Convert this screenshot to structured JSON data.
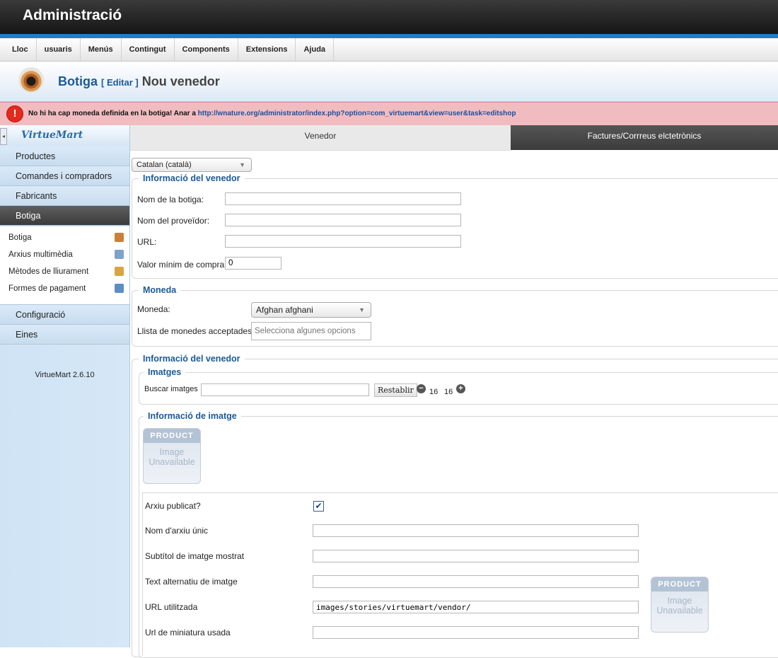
{
  "header": {
    "title": "Administració"
  },
  "menu": [
    "Lloc",
    "usuaris",
    "Menús",
    "Contingut",
    "Components",
    "Extensions",
    "Ajuda"
  ],
  "page": {
    "title": "Botiga",
    "edit": "[ Editar ]",
    "subtitle": "Nou venedor"
  },
  "alert": {
    "icon": "!",
    "text": "No hi ha cap moneda definida en la botiga! Anar a ",
    "link": "http://wnature.org/administrator/index.php?option=com_virtuemart&view=user&task=editshop"
  },
  "sidebar": {
    "logo": "VirtueMart",
    "collapse_icon": "◂",
    "items": [
      {
        "label": "Productes"
      },
      {
        "label": "Comandes i compradors"
      },
      {
        "label": "Fabricants"
      },
      {
        "label": "Botiga"
      }
    ],
    "sub_items": [
      {
        "label": "Botiga",
        "icon": "shop-icon",
        "color": "#c9803a"
      },
      {
        "label": "Arxius multimèdia",
        "icon": "media-icon",
        "color": "#7fa2c8"
      },
      {
        "label": "Mètodes de lliurament",
        "icon": "truck-icon",
        "color": "#d9a441"
      },
      {
        "label": "Formes de pagament",
        "icon": "payment-icon",
        "color": "#5b8ec2"
      }
    ],
    "items_after": [
      {
        "label": "Configuració"
      },
      {
        "label": "Eines"
      }
    ],
    "version": "VirtueMart 2.6.10"
  },
  "tabs": [
    {
      "label": "Venedor",
      "active": true
    },
    {
      "label": "Factures/Corrreus elctetrònics",
      "active": false
    }
  ],
  "language_select": {
    "value": "Catalan (català)",
    "arrow": "▼"
  },
  "vendor_info": {
    "legend": "Informació del venedor",
    "store_name_label": "Nom de la botiga:",
    "store_name_value": "",
    "provider_label": "Nom del proveïdor:",
    "provider_value": "",
    "url_label": "URL:",
    "url_value": "",
    "min_purchase_label": "Valor mínim de compra:",
    "min_purchase_value": "0"
  },
  "currency": {
    "legend": "Moneda",
    "currency_label": "Moneda:",
    "currency_value": "Afghan afghani",
    "accepted_label": "Llista de monedes acceptades:",
    "accepted_placeholder": "Selecciona algunes opcions"
  },
  "vendor_info_2": {
    "legend": "Informació del venedor"
  },
  "images": {
    "legend": "Imatges",
    "search_label": "Buscar imatges",
    "search_value": "",
    "reset_button": "Restablir",
    "minus_icon": "−",
    "plus_icon": "+",
    "count_left": "16",
    "count_right": "16"
  },
  "image_info": {
    "legend": "Informació de imatge",
    "placeholder_top": "PRODUCT",
    "placeholder_line1": "Image",
    "placeholder_line2": "Unavailable",
    "published_label": "Arxiu publicat?",
    "published_checked": true,
    "check_mark": "✔",
    "unique_name_label": "Nom d'arxiu únic",
    "unique_name_value": "",
    "subtitle_label": "Subtítol de imatge mostrat",
    "subtitle_value": "",
    "alt_text_label": "Text alternatiu de imatge",
    "alt_text_value": "",
    "url_label": "URL utilitzada",
    "url_value": "images/stories/virtuemart/vendor/",
    "thumb_url_label": "Url de miniatura usada",
    "thumb_url_value": ""
  }
}
